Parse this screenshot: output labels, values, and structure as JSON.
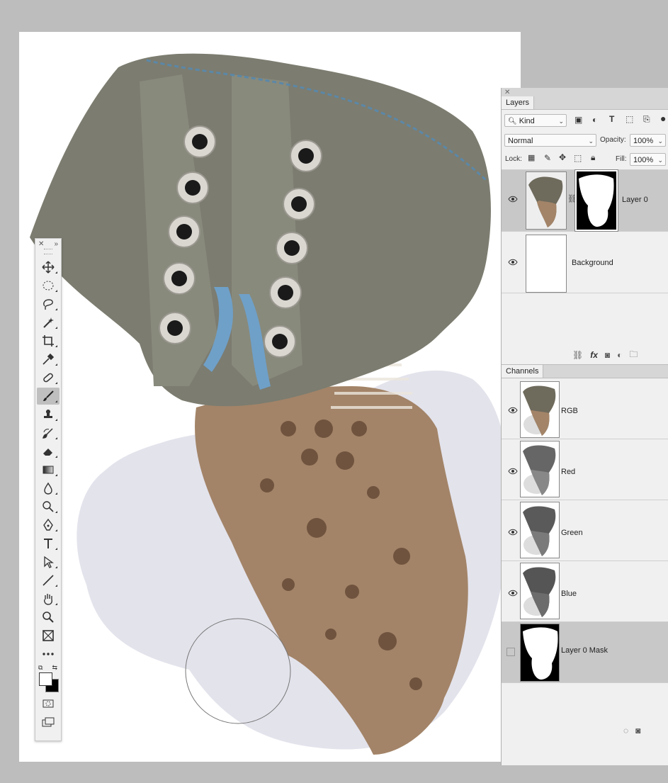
{
  "layers_panel": {
    "tab": "Layers",
    "filter_kind": "Kind",
    "blend_mode": "Normal",
    "opacity_label": "Opacity:",
    "opacity_value": "100%",
    "lock_label": "Lock:",
    "fill_label": "Fill:",
    "fill_value": "100%",
    "layers": [
      {
        "name": "Layer 0",
        "selected": true,
        "has_mask": true,
        "visible": true
      },
      {
        "name": "Background",
        "selected": false,
        "has_mask": false,
        "visible": true
      }
    ],
    "footer": {
      "fx": "fx"
    }
  },
  "channels_panel": {
    "tab": "Channels",
    "channels": [
      {
        "name": "RGB",
        "visible": true,
        "selected": false
      },
      {
        "name": "Red",
        "visible": true,
        "selected": false
      },
      {
        "name": "Green",
        "visible": true,
        "selected": false
      },
      {
        "name": "Blue",
        "visible": true,
        "selected": false
      },
      {
        "name": "Layer 0 Mask",
        "visible": false,
        "selected": true
      }
    ]
  },
  "toolbar": {
    "tools": [
      "move-tool",
      "marquee-tool",
      "lasso-tool",
      "magic-wand-tool",
      "crop-tool",
      "eyedropper-tool",
      "healing-brush-tool",
      "brush-tool",
      "clone-stamp-tool",
      "history-brush-tool",
      "eraser-tool",
      "gradient-tool",
      "blur-tool",
      "dodge-tool",
      "pen-tool",
      "type-tool",
      "path-selection-tool",
      "line-tool",
      "hand-tool",
      "zoom-tool",
      "frame-tool",
      "more-tools"
    ],
    "active_tool": "brush-tool",
    "foreground_color": "#ffffff",
    "background_color": "#000000"
  },
  "colors": {
    "app_background": "#bdbdbd",
    "panel_background": "#f0f0f0",
    "selected_row": "#c8c8c8"
  }
}
